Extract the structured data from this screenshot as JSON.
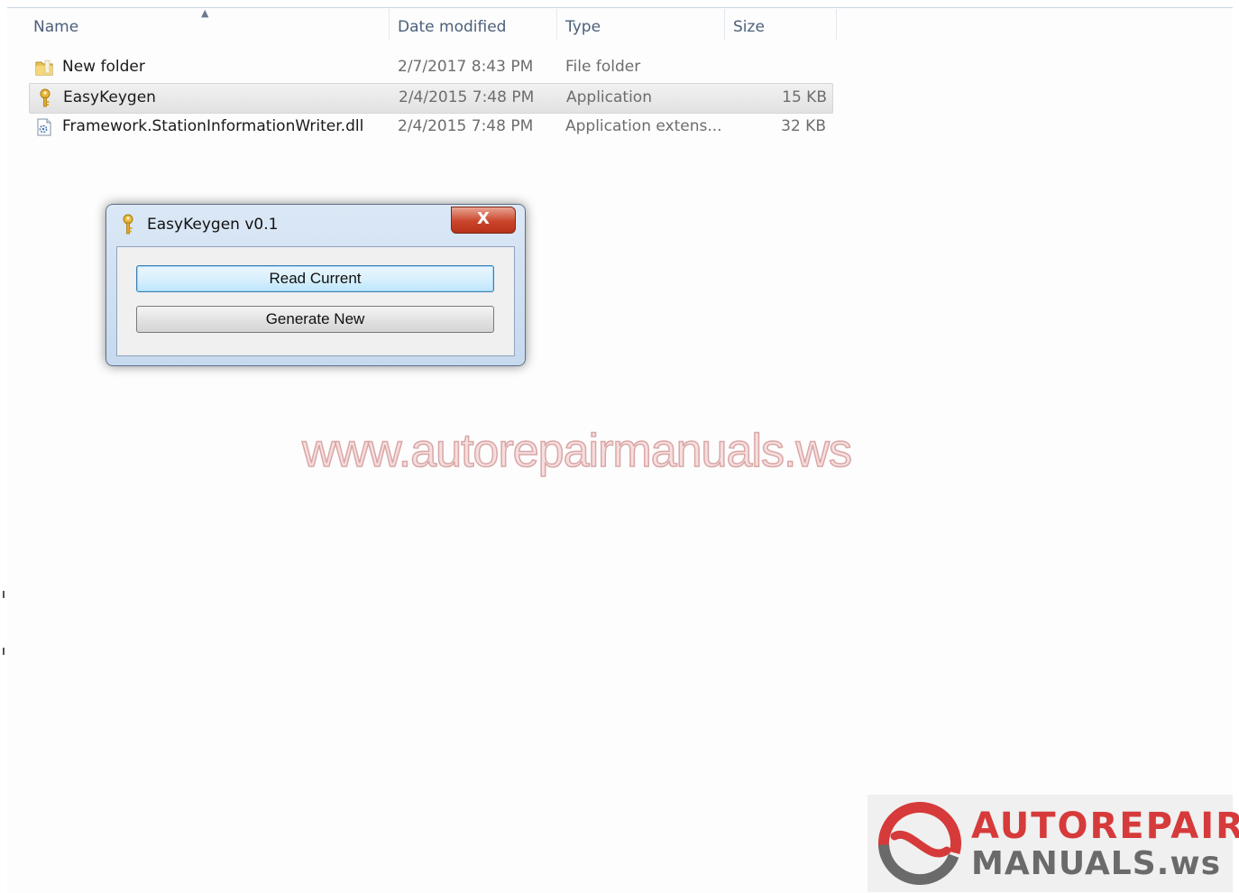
{
  "columns": {
    "name": "Name",
    "date_modified": "Date modified",
    "type": "Type",
    "size": "Size"
  },
  "files": [
    {
      "name": "New folder",
      "date": "2/7/2017 8:43 PM",
      "type": "File folder",
      "size": "",
      "icon": "folder-icon"
    },
    {
      "name": "EasyKeygen",
      "date": "2/4/2015 7:48 PM",
      "type": "Application",
      "size": "15 KB",
      "icon": "key-app-icon",
      "selected": true
    },
    {
      "name": "Framework.StationInformationWriter.dll",
      "date": "2/4/2015 7:48 PM",
      "type": "Application extens...",
      "size": "32 KB",
      "icon": "dll-file-icon"
    }
  ],
  "dialog": {
    "title": "EasyKeygen v0.1",
    "close_label": "X",
    "read_current_label": "Read Current",
    "generate_new_label": "Generate New"
  },
  "watermark": "www.autorepairmanuals.ws",
  "logo": {
    "line1": "AUTOREPAIR",
    "line2": "MANUALS.ws"
  },
  "colors": {
    "selection": "#e6e6e6",
    "header_text": "#4c607a",
    "dialog_frame": "#c6d9ee",
    "close_button": "#c9452b",
    "logo_red": "#d63a3a"
  }
}
